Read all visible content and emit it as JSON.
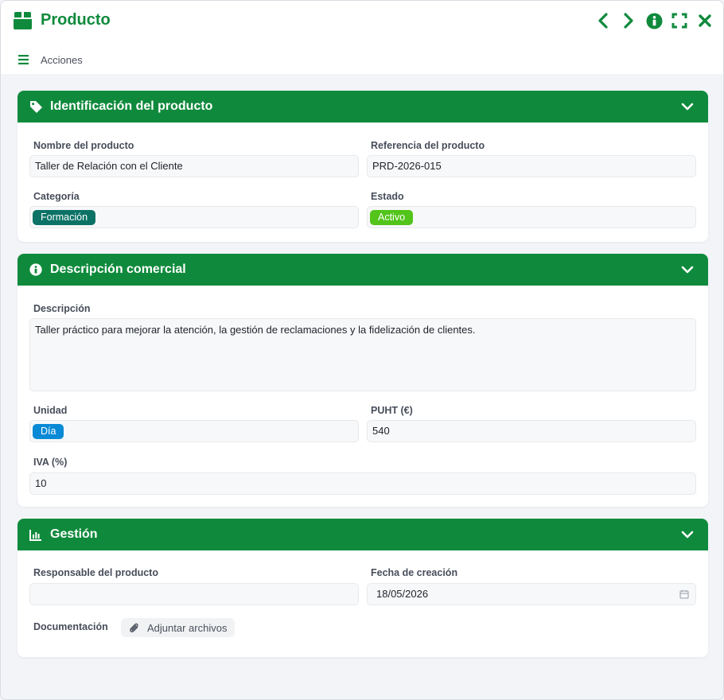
{
  "window": {
    "title": "Producto",
    "app_icon": "box-icon",
    "actions": [
      "chevron-left-icon",
      "chevron-right-icon",
      "info-icon",
      "expand-icon",
      "close-icon"
    ]
  },
  "toolbar": {
    "menu_icon": "hamburger-icon",
    "label": "Acciones"
  },
  "colors": {
    "primary": "#0f8a3c",
    "category_chip": "#0c7266",
    "status_chip": "#52c41a",
    "unit_chip": "#0a8ad6"
  },
  "sections": {
    "identification": {
      "title": "Identificación del producto",
      "icon": "tag-icon",
      "name_label": "Nombre del producto",
      "name_value": "Taller de Relación con el Cliente",
      "reference_label": "Referencia del producto",
      "reference_value": "PRD-2026-015",
      "category_label": "Categoría",
      "category_value": "Formación",
      "status_label": "Estado",
      "status_value": "Activo"
    },
    "commercial": {
      "title": "Descripción comercial",
      "icon": "info-circle-icon",
      "description_label": "Descripción",
      "description_value": "Taller práctico para mejorar la atención, la gestión de reclamaciones y la fidelización de clientes.",
      "unit_label": "Unidad",
      "unit_value": "Día",
      "price_label": "PUHT (€)",
      "price_value": "540",
      "vat_label": "IVA (%)",
      "vat_value": "10"
    },
    "management": {
      "title": "Gestión",
      "icon": "bar-chart-icon",
      "owner_label": "Responsable del producto",
      "owner_value": "",
      "created_label": "Fecha de creación",
      "created_value": "18/05/2026",
      "docs_label": "Documentación",
      "attach_label": "Adjuntar archivos"
    }
  }
}
